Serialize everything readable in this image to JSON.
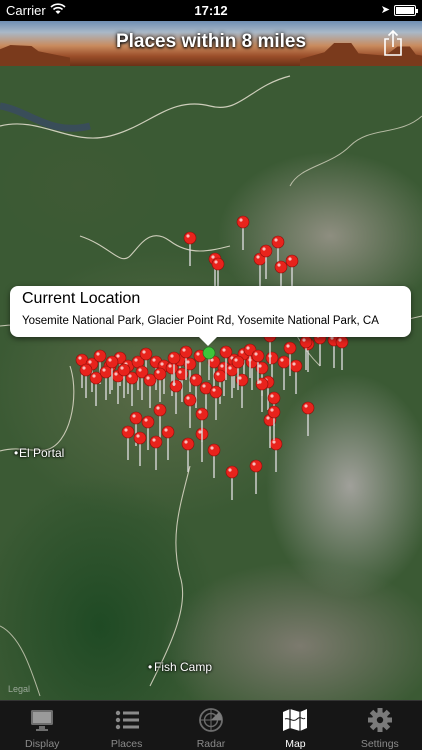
{
  "status_bar": {
    "carrier": "Carrier",
    "time": "17:12"
  },
  "header": {
    "title": "Places within 8 miles",
    "share_icon": "share-icon"
  },
  "map": {
    "callout": {
      "title": "Current Location",
      "subtitle": "Yosemite National Park,  Glacier Point Rd,  Yosemite National Park, CA"
    },
    "places": [
      {
        "name": "El Portal"
      },
      {
        "name": "Fish Camp"
      }
    ],
    "legal": "Legal",
    "pin_color": "#e8231c",
    "current_location_color": "#3ec43a"
  },
  "tabs": [
    {
      "label": "Display",
      "icon": "display-icon"
    },
    {
      "label": "Places",
      "icon": "list-icon"
    },
    {
      "label": "Radar",
      "icon": "radar-icon"
    },
    {
      "label": "Map",
      "icon": "map-icon",
      "active": true
    },
    {
      "label": "Settings",
      "icon": "gear-icon"
    }
  ]
}
